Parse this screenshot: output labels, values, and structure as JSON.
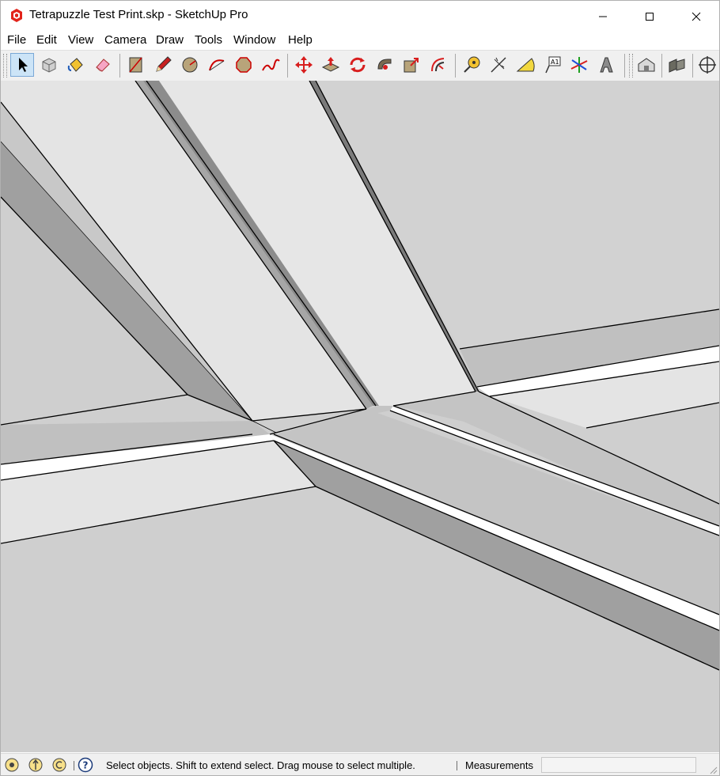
{
  "window": {
    "title": "Tetrapuzzle Test Print.skp - SketchUp Pro",
    "controls": [
      "minimize-icon",
      "maximize-icon",
      "close-icon"
    ]
  },
  "menu": {
    "file": "File",
    "edit": "Edit",
    "view": "View",
    "camera": "Camera",
    "draw": "Draw",
    "tools": "Tools",
    "window": "Window",
    "help": "Help"
  },
  "toolbar": {
    "tools": [
      "select-arrow-icon",
      "make-component-icon",
      "paint-bucket-icon",
      "eraser-icon",
      "rectangle-icon",
      "pencil-line-icon",
      "circle-icon",
      "arc-icon",
      "polygon-icon",
      "freehand-icon",
      "move-icon",
      "push-pull-icon",
      "rotate-icon",
      "follow-me-icon",
      "scale-icon",
      "offset-icon",
      "tape-measure-icon",
      "dimension-icon",
      "protractor-icon",
      "text-icon",
      "axes-icon",
      "3d-text-icon",
      "warehouse-icon",
      "extension-warehouse-icon",
      "orbit-icon"
    ],
    "active_tool": "select-arrow-icon"
  },
  "status": {
    "icons": [
      "geo-location-icon",
      "credits-icon",
      "copyright-icon",
      "help-icon"
    ],
    "hint": "Select objects. Shift to extend select. Drag mouse to select multiple.",
    "measurements_label": "Measurements",
    "measurements_value": ""
  },
  "colors": {
    "viewport_bg": "#cfcfcf",
    "face_light": "#e6e6e6",
    "face_mid": "#c4c4c4",
    "face_dark": "#a0a0a0",
    "face_white": "#ffffff",
    "edge": "#000000",
    "toolbar_bg": "#f0f0f0",
    "active_tool_bg": "#cce4f7"
  }
}
